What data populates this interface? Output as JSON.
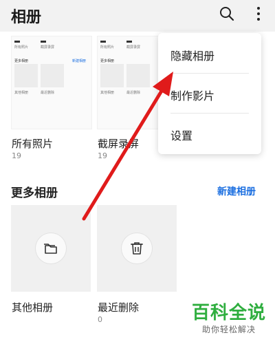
{
  "header": {
    "title": "相册"
  },
  "albums": [
    {
      "name": "所有照片",
      "count": "19"
    },
    {
      "name": "截屏录屏",
      "count": "19"
    }
  ],
  "mini_preview": {
    "row1": [
      "所有照片",
      "截屏录屏"
    ],
    "section": "更多相册",
    "new": "新建相册",
    "row2": [
      "其他相册",
      "最近删除"
    ]
  },
  "more_albums": {
    "title": "更多相册",
    "new_album_label": "新建相册",
    "items": [
      {
        "name": "其他相册",
        "count": ""
      },
      {
        "name": "最近删除",
        "count": "0"
      }
    ]
  },
  "menu": {
    "items": [
      "隐藏相册",
      "制作影片",
      "设置"
    ]
  },
  "watermark": {
    "title": "百科全说",
    "subtitle": "助你轻松解决"
  },
  "colors": {
    "accent": "#1a6ee0",
    "arrow": "#e01b1b",
    "watermark": "#2fae3f"
  }
}
